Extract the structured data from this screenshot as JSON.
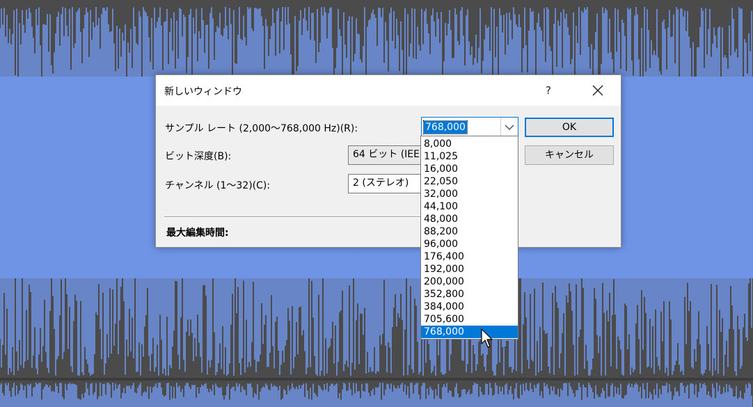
{
  "dialog": {
    "title": "新しいウィンドウ",
    "help_label": "?",
    "sample_rate_label": "サンプル レート (2,000〜768,000 Hz)(R):",
    "sample_rate_value": "768,000",
    "bit_depth_label": "ビット深度(B):",
    "bit_depth_value": "64 ビット (IEEE",
    "channels_label": "チャンネル (1〜32)(C):",
    "channels_value": "2 (ステレオ)",
    "max_edit_label": "最大編集時間:",
    "ok_label": "OK",
    "cancel_label": "キャンセル"
  },
  "dropdown": {
    "options": [
      "8,000",
      "11,025",
      "16,000",
      "22,050",
      "32,000",
      "44,100",
      "48,000",
      "88,200",
      "96,000",
      "176,400",
      "192,000",
      "200,000",
      "352,800",
      "384,000",
      "705,600",
      "768,000"
    ],
    "selected": "768,000"
  },
  "colors": {
    "waveform": "#6f94e6",
    "background": "#4b4b4b",
    "accent": "#0078d7"
  },
  "icons": {
    "close": "close-icon",
    "dropdown": "chevron-down-icon",
    "cursor": "mouse-pointer-icon"
  }
}
